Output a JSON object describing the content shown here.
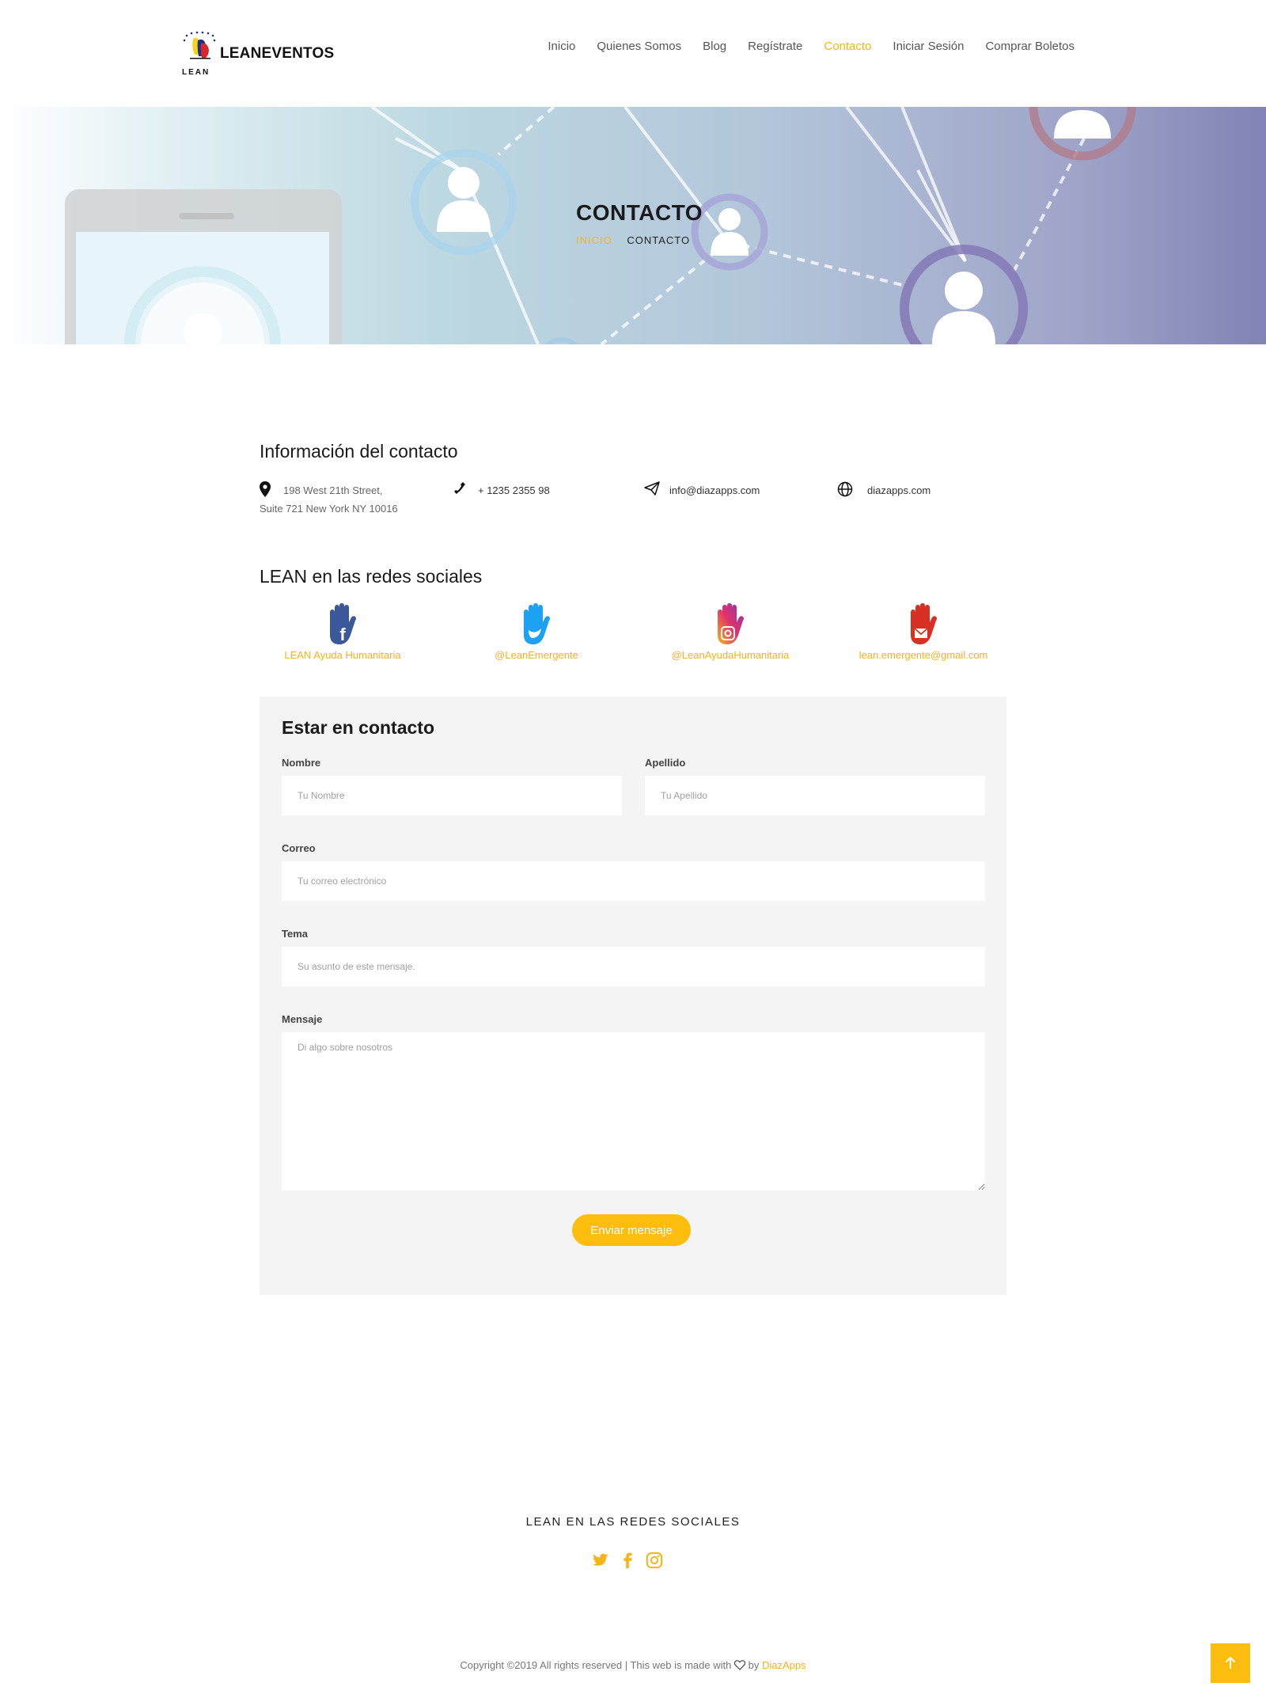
{
  "brand": {
    "name": "LEANEVENTOS",
    "sub": "LEAN"
  },
  "nav": {
    "items": [
      {
        "label": "Inicio"
      },
      {
        "label": "Quienes Somos"
      },
      {
        "label": "Blog"
      },
      {
        "label": "Regístrate"
      },
      {
        "label": "Contacto"
      },
      {
        "label": "Iniciar Sesión"
      },
      {
        "label": "Comprar Boletos"
      }
    ],
    "active": "Contacto"
  },
  "hero": {
    "title": "CONTACTO",
    "breadcrumb": {
      "home": "INICIO",
      "current": "CONTACTO"
    }
  },
  "contact_info": {
    "heading": "Información del contacto",
    "address_line1": "198 West 21th Street,",
    "address_line2": "Suite 721 New York NY 10016",
    "phone": "+ 1235 2355 98",
    "email": "info@diazapps.com",
    "website": "diazapps.com"
  },
  "social": {
    "heading": "LEAN en las redes sociales",
    "items": [
      {
        "label": "LEAN Ayuda Humanitaria",
        "icon": "facebook-hand-icon",
        "color": "#3b5998"
      },
      {
        "label": "@LeanEmergente",
        "icon": "twitter-hand-icon",
        "color": "#1da1f2"
      },
      {
        "label": "@LeanAyudaHumanitaria",
        "icon": "instagram-hand-icon",
        "color": "#e1306c"
      },
      {
        "label": "lean.emergente@gmail.com",
        "icon": "gmail-hand-icon",
        "color": "#d93025"
      }
    ]
  },
  "form": {
    "title": "Estar en contacto",
    "first_name_label": "Nombre",
    "first_name_placeholder": "Tu Nombre",
    "last_name_label": "Apellido",
    "last_name_placeholder": "Tu Apellido",
    "email_label": "Correo",
    "email_placeholder": "Tu correo electrónico",
    "subject_label": "Tema",
    "subject_placeholder": "Su asunto de este mensaje.",
    "message_label": "Mensaje",
    "message_placeholder": "Di algo sobre nosotros",
    "submit_label": "Enviar mensaje"
  },
  "footer": {
    "title": "LEAN EN LAS REDES SOCIALES",
    "icons": [
      "twitter-icon",
      "facebook-icon",
      "instagram-icon"
    ],
    "copyright_prefix": "Copyright ©2019 All rights reserved | This web is made with",
    "copyright_by": "by",
    "copyright_brand": "DiazApps"
  },
  "colors": {
    "accent": "#f7b416",
    "button": "#fdbd0f",
    "form_bg": "#f4f4f4"
  }
}
